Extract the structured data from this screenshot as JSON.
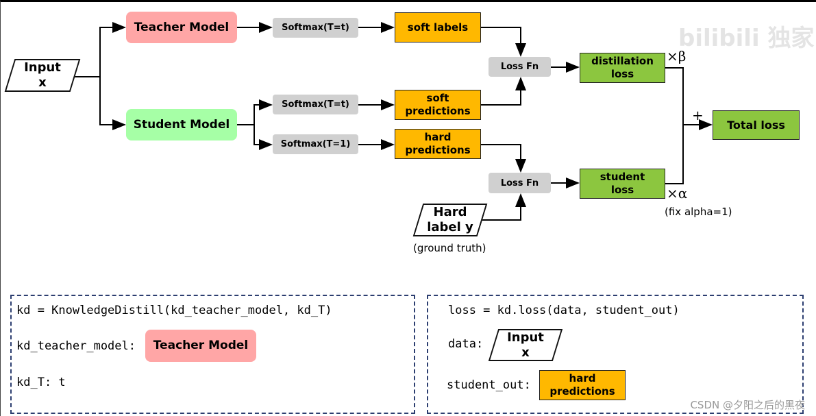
{
  "diagram": {
    "input": "Input\nx",
    "teacher": "Teacher Model",
    "student": "Student Model",
    "softmax_teacher": "Softmax(T=t)",
    "softmax_student_soft": "Softmax(T=t)",
    "softmax_student_hard": "Softmax(T=1)",
    "soft_labels": "soft labels",
    "soft_predictions": "soft\npredictions",
    "hard_predictions": "hard\npredictions",
    "loss_fn_top": "Loss Fn",
    "loss_fn_bottom": "Loss Fn",
    "distillation_loss": "distillation\nloss",
    "student_loss": "student\nloss",
    "total_loss": "Total loss",
    "beta": "×β",
    "alpha": "×α",
    "plus": "+",
    "fix_alpha": "(fix alpha=1)",
    "hard_label": "Hard\nlabel y",
    "ground_truth": "(ground truth)"
  },
  "code_left": {
    "line1": "kd = KnowledgeDistill(kd_teacher_model, kd_T)",
    "line2_label": "kd_teacher_model:",
    "line2_box": "Teacher Model",
    "line3": "kd_T: t"
  },
  "code_right": {
    "line1": "loss = kd.loss(data, student_out)",
    "line2_label": "data:",
    "line2_box": "Input\nx",
    "line3_label": "student_out:",
    "line3_box": "hard\npredictions"
  },
  "watermarks": {
    "top": "bilibili 独家",
    "bottom": "CSDN @夕阳之后的黑夜"
  },
  "colors": {
    "teacher": "#ffa6a6",
    "student": "#a6ffa6",
    "softmax": "#d0d0d0",
    "output": "#ffb800",
    "loss": "#8cc63f",
    "dash": "#2c3e70"
  }
}
